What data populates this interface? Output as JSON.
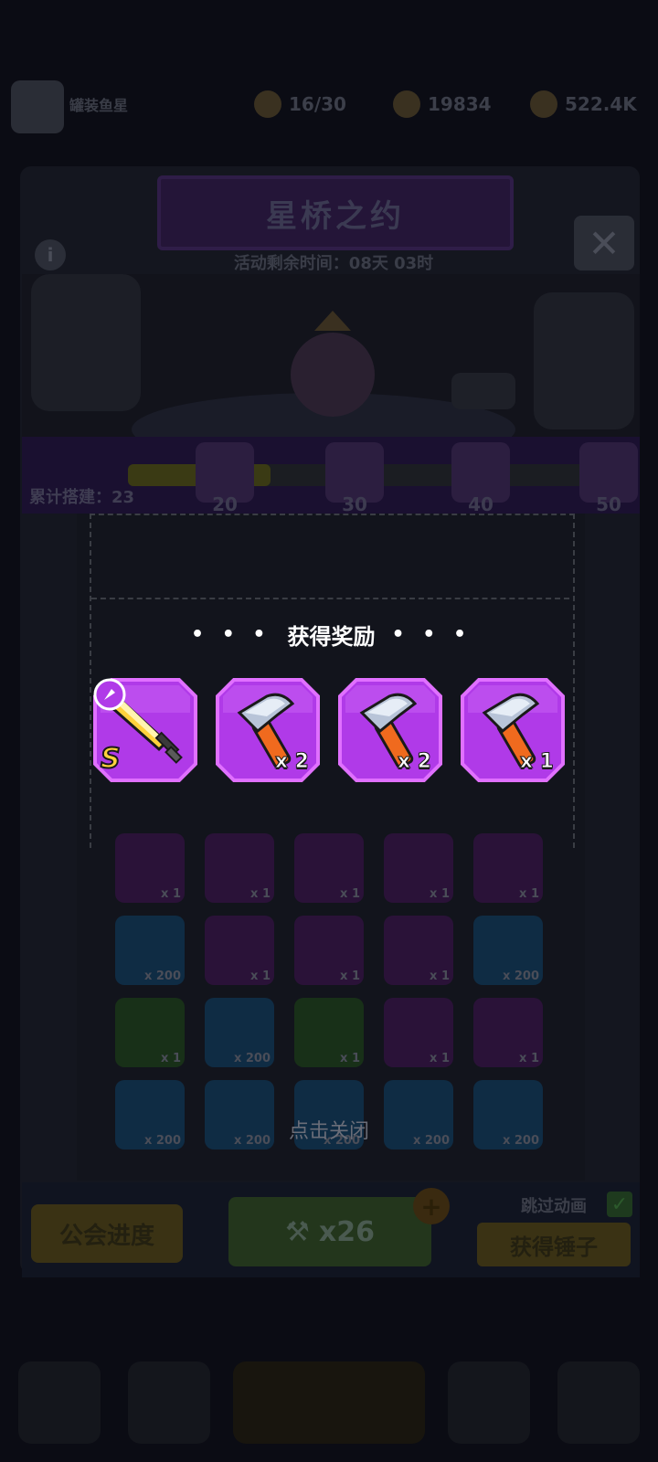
{
  "top": {
    "player_name": "罐装鱼星",
    "energy": "16/30",
    "gems": "19834",
    "gold": "522.4K"
  },
  "event": {
    "title": "星桥之约",
    "timer": "活动剩余时间：08天 03时",
    "build_count": "累计搭建：23",
    "milestones": [
      "20",
      "30",
      "40",
      "50"
    ],
    "progress_fraction": 0.3
  },
  "grid": {
    "rows": [
      [
        {
          "c": "p",
          "q": "x 1"
        },
        {
          "c": "p",
          "q": "x 1"
        },
        {
          "c": "p",
          "q": "x 1"
        },
        {
          "c": "p",
          "q": "x 1"
        },
        {
          "c": "p",
          "q": "x 1"
        }
      ],
      [
        {
          "c": "b",
          "q": "x 200"
        },
        {
          "c": "p",
          "q": "x 1"
        },
        {
          "c": "p",
          "q": "x 1"
        },
        {
          "c": "p",
          "q": "x 1"
        },
        {
          "c": "b",
          "q": "x 200"
        }
      ],
      [
        {
          "c": "g",
          "q": "x 1"
        },
        {
          "c": "b",
          "q": "x 200"
        },
        {
          "c": "g",
          "q": "x 1"
        },
        {
          "c": "p",
          "q": "x 1"
        },
        {
          "c": "p",
          "q": "x 1"
        }
      ],
      [
        {
          "c": "b",
          "q": "x 200"
        },
        {
          "c": "b",
          "q": "x 200"
        },
        {
          "c": "b",
          "q": "x 200"
        },
        {
          "c": "b",
          "q": "x 200"
        },
        {
          "c": "b",
          "q": "x 200"
        }
      ]
    ]
  },
  "reward": {
    "title": "获得奖励",
    "dots": "• • •",
    "items": [
      {
        "icon": "sword-icon",
        "rank": "S",
        "qty": ""
      },
      {
        "icon": "hammer-icon",
        "qty": "x 2"
      },
      {
        "icon": "hammer-icon",
        "qty": "x 2"
      },
      {
        "icon": "hammer-icon",
        "qty": "x 1"
      }
    ],
    "tap_close": "点击关闭"
  },
  "bottom": {
    "guild_progress": "公会进度",
    "hammer_count": "x26",
    "skip_animation": "跳过动画",
    "get_hammer": "获得锤子"
  },
  "colors": {
    "reward_purple": "#b03ae8",
    "reward_border": "#e070ff",
    "hammer_handle": "#f06a1e"
  }
}
